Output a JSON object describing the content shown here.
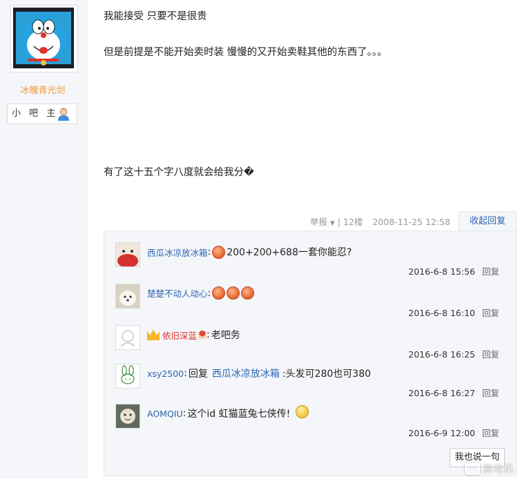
{
  "user": {
    "name": "冰魄青光剑",
    "role": "小 吧 主"
  },
  "post": {
    "lines": [
      "我能接受 只要不是很贵",
      "但是前提是不能开始卖时装 慢慢的又开始卖鞋其他的东西了。。。",
      "有了这十五个字八度就会给我分�"
    ],
    "meta": {
      "report": "举报",
      "floor": "12楼",
      "datetime": "2008-11-25 12:58",
      "collapse": "收起回复"
    }
  },
  "replies": [
    {
      "user": "西瓜冰凉放冰箱",
      "text": "200+200+688一套你能忍?",
      "time": "2016-6-8 15:56",
      "action": "回复"
    },
    {
      "user": "楚楚不动人动心",
      "text": "",
      "time": "2016-6-8 16:10",
      "action": "回复"
    },
    {
      "user": "依旧深蓝",
      "text": "老吧务",
      "time": "2016-6-8 16:25",
      "action": "回复"
    },
    {
      "user": "xsy2500",
      "reply_word": "回复",
      "target": "西瓜冰凉放冰箱",
      "text": ":头发可280也可380",
      "time": "2016-6-8 16:27",
      "action": "回复"
    },
    {
      "user": "AOMQIU",
      "text": "这个id 虹猫蓝兔七侠传!",
      "time": "2016-6-9 12:00",
      "action": "回复"
    }
  ],
  "say_button": "我也说一句",
  "watermark": "游戏机"
}
